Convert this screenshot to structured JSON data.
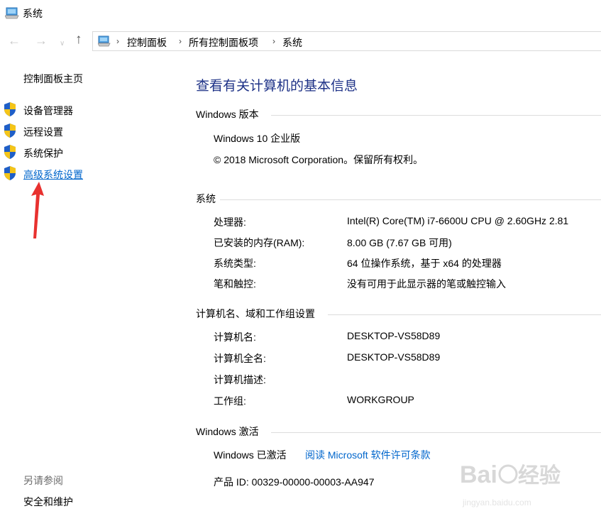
{
  "window": {
    "title": "系统",
    "title_icon": "monitor-icon"
  },
  "nav": {
    "back_icon": "arrow-left-icon",
    "forward_icon": "arrow-right-icon",
    "recent_icon": "chevron-down-icon",
    "up_icon": "arrow-up-icon",
    "breadcrumbs": [
      "控制面板",
      "所有控制面板项",
      "系统"
    ],
    "separator": "›"
  },
  "sidebar": {
    "home": "控制面板主页",
    "items": [
      {
        "label": "设备管理器",
        "icon": "shield-icon"
      },
      {
        "label": "远程设置",
        "icon": "shield-icon"
      },
      {
        "label": "系统保护",
        "icon": "shield-icon"
      },
      {
        "label": "高级系统设置",
        "icon": "shield-icon"
      }
    ],
    "see_also_header": "另请参阅",
    "see_also_items": [
      "安全和维护"
    ]
  },
  "main": {
    "title": "查看有关计算机的基本信息",
    "windows_edition": {
      "header": "Windows 版本",
      "edition": "Windows 10 企业版",
      "copyright": "© 2018 Microsoft Corporation。保留所有权利。"
    },
    "system": {
      "header": "系统",
      "rows": [
        {
          "label": "处理器:",
          "value": "Intel(R) Core(TM) i7-6600U CPU @ 2.60GHz   2.81"
        },
        {
          "label": "已安装的内存(RAM):",
          "value": "8.00 GB (7.67 GB 可用)"
        },
        {
          "label": "系统类型:",
          "value": "64 位操作系统，基于 x64 的处理器"
        },
        {
          "label": "笔和触控:",
          "value": "没有可用于此显示器的笔或触控输入"
        }
      ]
    },
    "computer": {
      "header": "计算机名、域和工作组设置",
      "rows": [
        {
          "label": "计算机名:",
          "value": "DESKTOP-VS58D89"
        },
        {
          "label": "计算机全名:",
          "value": "DESKTOP-VS58D89"
        },
        {
          "label": "计算机描述:",
          "value": ""
        },
        {
          "label": "工作组:",
          "value": "WORKGROUP"
        }
      ]
    },
    "activation": {
      "header": "Windows 激活",
      "status": "Windows 已激活",
      "license_link": "阅读 Microsoft 软件许可条款",
      "product_id": "产品 ID: 00329-00000-00003-AA947"
    }
  },
  "colors": {
    "title_blue": "#1e3287",
    "link_blue": "#0066cc",
    "annotation_red": "#e8312f"
  },
  "watermark": {
    "text": "Baidu经验",
    "url": "jingyan.baidu.com"
  }
}
